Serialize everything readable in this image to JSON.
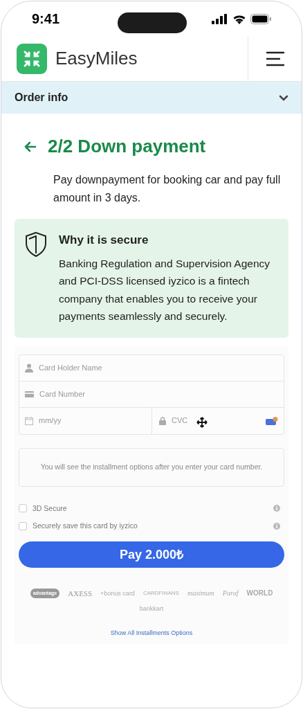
{
  "status_bar": {
    "time": "9:41"
  },
  "header": {
    "brand": "EasyMiles"
  },
  "order_info": {
    "label": "Order info",
    "expanded": false
  },
  "step": {
    "title": "2/2 Down payment",
    "description": "Pay downpayment for booking car and pay full amount in 3 days."
  },
  "secure_note": {
    "title": "Why it is secure",
    "text": "Banking Regulation and Supervision Agency and PCI-DSS licensed iyzico is a fintech company that enables you to receive your payments seamlessly and securely."
  },
  "card_form": {
    "holder_placeholder": "Card Holder Name",
    "number_placeholder": "Card Number",
    "expiry_placeholder": "mm/yy",
    "cvc_placeholder": "CVC"
  },
  "installments_note": "You will see the installment options after you enter your card number.",
  "options": [
    {
      "label": "3D Secure",
      "checked": false
    },
    {
      "label": "Securely save this card by iyzico",
      "checked": false
    }
  ],
  "pay_button": "Pay 2.000₺",
  "card_brands": [
    "advantage",
    "AXESS",
    "+bonus card",
    "CARDFINANS",
    "maximum",
    "Paraf",
    "WORLD",
    "bankkart"
  ],
  "installments_link": "Show All Installments Options"
}
